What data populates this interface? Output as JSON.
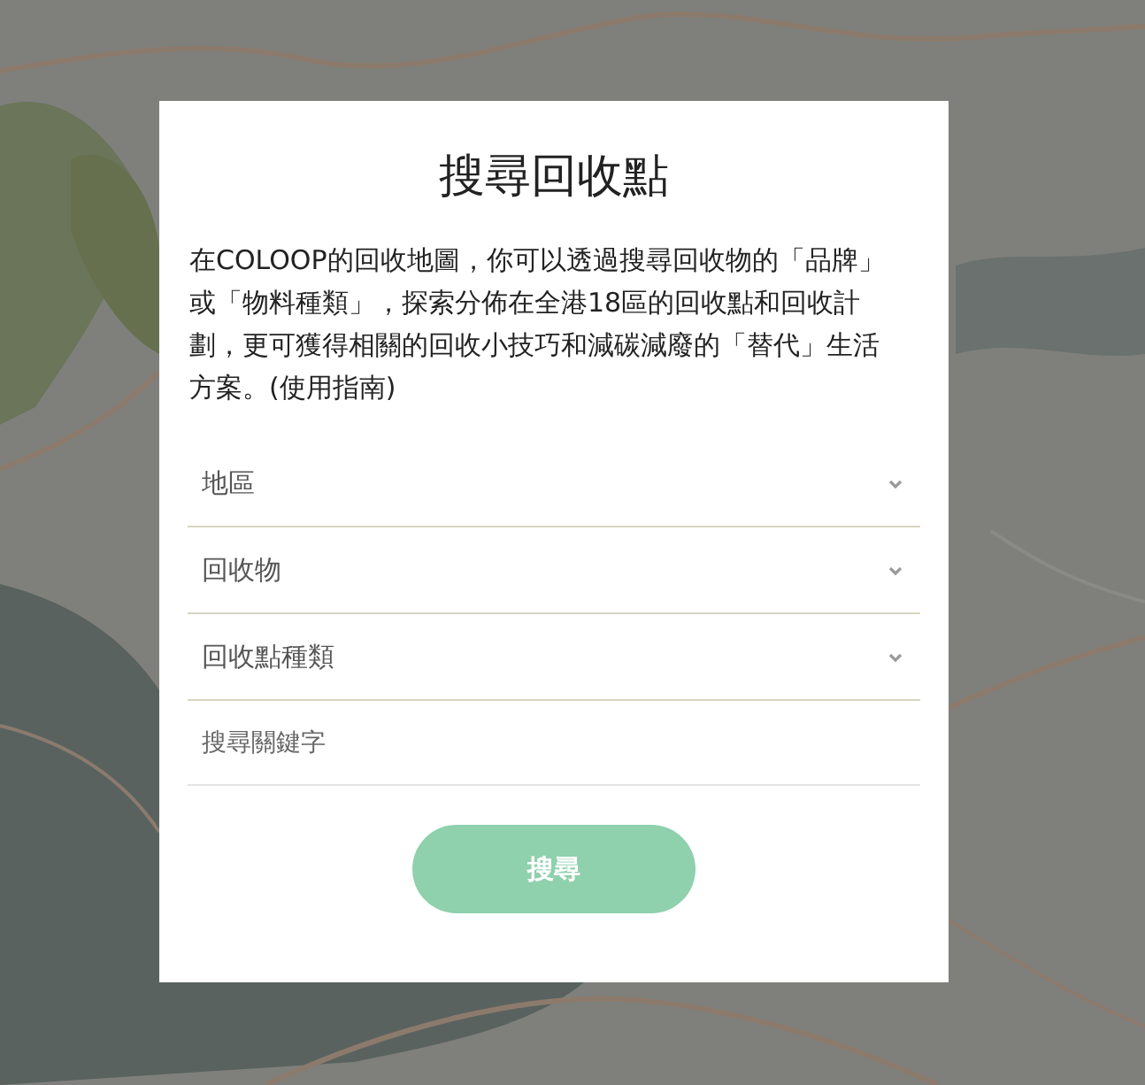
{
  "dialog": {
    "title": "搜尋回收點",
    "description": "在COLOOP的回收地圖，你可以透過搜尋回收物的「品牌」或「物料種類」，探索分佈在全港18區的回收點和回收計劃，更可獲得相關的回收小技巧和減碳減廢的「替代」生活方案。(使用指南)",
    "filters": [
      {
        "kind": "select",
        "placeholder": "地區"
      },
      {
        "kind": "select",
        "placeholder": "回收物"
      },
      {
        "kind": "select",
        "placeholder": "回收點種類"
      },
      {
        "kind": "text",
        "placeholder": "搜尋關鍵字"
      }
    ],
    "search_button": {
      "label": "搜尋",
      "disabled": true
    }
  }
}
